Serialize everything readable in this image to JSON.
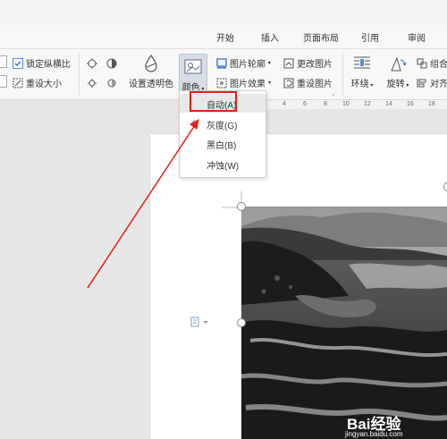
{
  "tabs": [
    "开始",
    "插入",
    "页面布局",
    "引用",
    "审阅"
  ],
  "ribbon": {
    "lock_ratio": "锁定纵横比",
    "reset_size": "重设大小",
    "set_transparent": "设置透明色",
    "color": "颜色",
    "pic_outline": "图片轮廓",
    "change_pic": "更改图片",
    "pic_effect": "图片效果",
    "reset_pic": "重设图片",
    "wrap": "环绕",
    "rotate": "旋转",
    "group": "组合",
    "align": "对齐"
  },
  "ruler": [
    "4",
    "6",
    "8",
    "10",
    "12",
    "14",
    "16",
    "18"
  ],
  "color_menu": [
    {
      "label": "自动(A)",
      "checked": false
    },
    {
      "label": "灰度(G)",
      "checked": true
    },
    {
      "label": "黑白(B)",
      "checked": false
    },
    {
      "label": "冲蚀(W)",
      "checked": false
    }
  ],
  "watermark": {
    "logo": "Bai经验",
    "url": "jingyan.baidu.com"
  },
  "colors": {
    "annotation_red": "#e0201b",
    "ribbon_bg": "#f8f8f8",
    "menu_highlight": "#e8e8e8"
  }
}
